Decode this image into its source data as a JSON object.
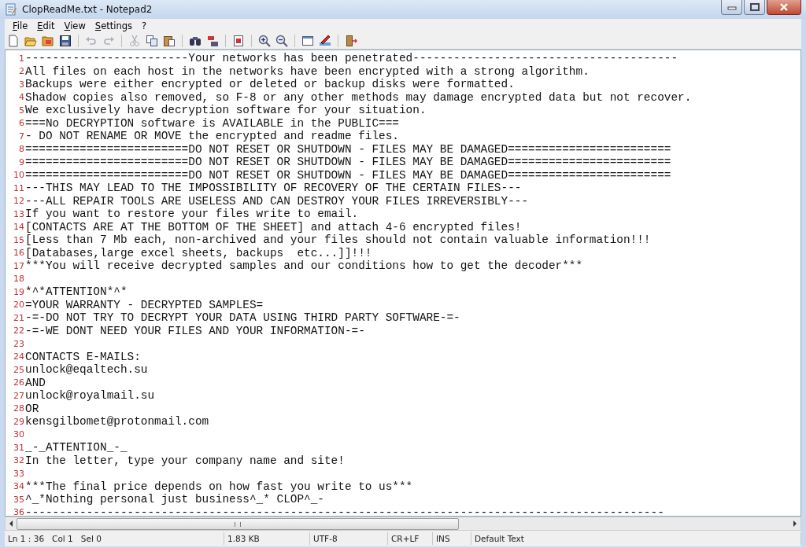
{
  "window": {
    "title": "ClopReadMe.txt - Notepad2"
  },
  "menu": [
    {
      "label": "File"
    },
    {
      "label": "Edit"
    },
    {
      "label": "View"
    },
    {
      "label": "Settings"
    },
    {
      "label": "?"
    }
  ],
  "toolbar": [
    {
      "kind": "new",
      "disabled": false
    },
    {
      "kind": "open",
      "disabled": false
    },
    {
      "kind": "browse",
      "disabled": false
    },
    {
      "kind": "save",
      "disabled": false
    },
    {
      "kind": "separator"
    },
    {
      "kind": "undo",
      "disabled": true
    },
    {
      "kind": "redo",
      "disabled": true
    },
    {
      "kind": "separator"
    },
    {
      "kind": "cut",
      "disabled": true
    },
    {
      "kind": "copy",
      "disabled": false
    },
    {
      "kind": "paste",
      "disabled": false
    },
    {
      "kind": "separator"
    },
    {
      "kind": "find",
      "disabled": false
    },
    {
      "kind": "replace",
      "disabled": false
    },
    {
      "kind": "separator"
    },
    {
      "kind": "wrap",
      "disabled": false
    },
    {
      "kind": "separator"
    },
    {
      "kind": "zoomin",
      "disabled": false
    },
    {
      "kind": "zoomout",
      "disabled": false
    },
    {
      "kind": "separator"
    },
    {
      "kind": "scheme",
      "disabled": false
    },
    {
      "kind": "customize",
      "disabled": false
    },
    {
      "kind": "separator"
    },
    {
      "kind": "exit",
      "disabled": false
    }
  ],
  "editor": {
    "lines": [
      {
        "number": "1",
        "text": "------------------------Your networks has been penetrated---------------------------------------"
      },
      {
        "number": "2",
        "text": "All files on each host in the networks have been encrypted with a strong algorithm."
      },
      {
        "number": "3",
        "text": "Backups were either encrypted or deleted or backup disks were formatted."
      },
      {
        "number": "4",
        "text": "Shadow copies also removed, so F-8 or any other methods may damage encrypted data but not recover."
      },
      {
        "number": "5",
        "text": "We exclusively have decryption software for your situation."
      },
      {
        "number": "6",
        "text": "===No DECRYPTION software is AVAILABLE in the PUBLIC==="
      },
      {
        "number": "7",
        "text": "- DO NOT RENAME OR MOVE the encrypted and readme files."
      },
      {
        "number": "8",
        "text": "========================DO NOT RESET OR SHUTDOWN - FILES MAY BE DAMAGED========================"
      },
      {
        "number": "9",
        "text": "========================DO NOT RESET OR SHUTDOWN - FILES MAY BE DAMAGED========================"
      },
      {
        "number": "10",
        "text": "========================DO NOT RESET OR SHUTDOWN - FILES MAY BE DAMAGED========================"
      },
      {
        "number": "11",
        "text": "---THIS MAY LEAD TO THE IMPOSSIBILITY OF RECOVERY OF THE CERTAIN FILES---"
      },
      {
        "number": "12",
        "text": "---ALL REPAIR TOOLS ARE USELESS AND CAN DESTROY YOUR FILES IRREVERSIBLY---"
      },
      {
        "number": "13",
        "text": "If you want to restore your files write to email."
      },
      {
        "number": "14",
        "text": "[CONTACTS ARE AT THE BOTTOM OF THE SHEET] and attach 4-6 encrypted files!"
      },
      {
        "number": "15",
        "text": "[Less than 7 Mb each, non-archived and your files should not contain valuable information!!!"
      },
      {
        "number": "16",
        "text": "[Databases,large excel sheets, backups  etc...]]!!!"
      },
      {
        "number": "17",
        "text": "***You will receive decrypted samples and our conditions how to get the decoder***"
      },
      {
        "number": "18"
      },
      {
        "number": "19",
        "text": "*^*ATTENTION*^*"
      },
      {
        "number": "20",
        "text": "=YOUR WARRANTY - DECRYPTED SAMPLES="
      },
      {
        "number": "21",
        "text": "-=-DO NOT TRY TO DECRYPT YOUR DATA USING THIRD PARTY SOFTWARE-=-"
      },
      {
        "number": "22",
        "text": "-=-WE DONT NEED YOUR FILES AND YOUR INFORMATION-=-"
      },
      {
        "number": "23"
      },
      {
        "number": "24",
        "text": "CONTACTS E-MAILS:"
      },
      {
        "number": "25",
        "text": "unlock@eqaltech.su"
      },
      {
        "number": "26",
        "text": "AND"
      },
      {
        "number": "27",
        "text": "unlock@royalmail.su"
      },
      {
        "number": "28",
        "text": "OR"
      },
      {
        "number": "29",
        "text": "kensgilbomet@protonmail.com"
      },
      {
        "number": "30"
      },
      {
        "number": "31",
        "text": "_-_ATTENTION_-_"
      },
      {
        "number": "32",
        "text": "In the letter, type your company name and site!"
      },
      {
        "number": "33"
      },
      {
        "number": "34",
        "text": "***The final price depends on how fast you write to us***"
      },
      {
        "number": "35",
        "text": "^_*Nothing personal just business^_* CLOP^_-"
      },
      {
        "number": "36",
        "text": "----------------------------------------------------------------------------------------------"
      }
    ]
  },
  "status_bar": [
    {
      "text": "Ln 1 : 36   Col 1   Sel 0"
    },
    {
      "text": "1.83 KB"
    },
    {
      "text": "UTF-8"
    },
    {
      "text": "CR+LF"
    },
    {
      "text": "INS"
    },
    {
      "text": "Default Text"
    }
  ]
}
